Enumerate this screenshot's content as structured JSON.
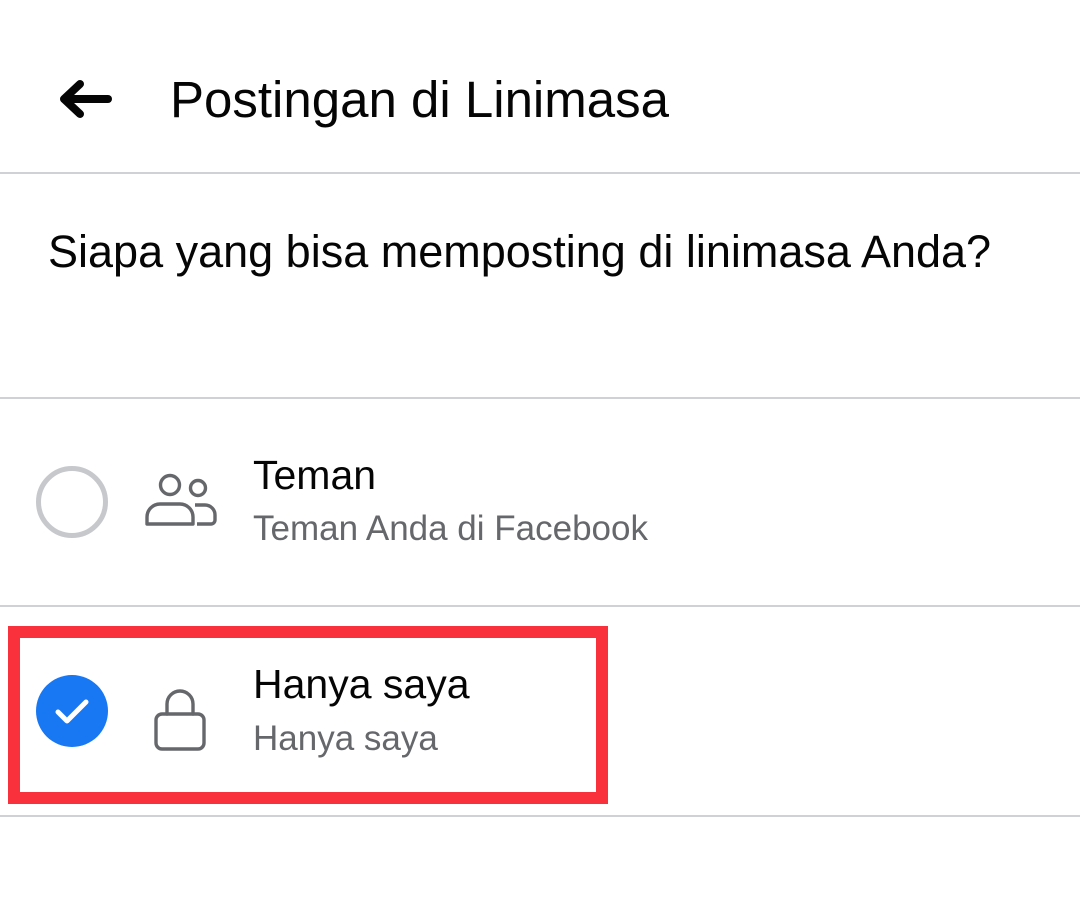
{
  "header": {
    "back_icon": "arrow-left-icon",
    "title": "Postingan di Linimasa"
  },
  "question": {
    "text": "Siapa yang bisa memposting di linimasa Anda?"
  },
  "options": [
    {
      "title": "Teman",
      "subtitle": "Teman Anda di Facebook",
      "icon": "friends-icon",
      "selected": false
    },
    {
      "title": "Hanya saya",
      "subtitle": "Hanya saya",
      "icon": "lock-icon",
      "selected": true
    }
  ],
  "colors": {
    "accent": "#1877f2",
    "highlight": "#f8313d",
    "divider": "#cfd1d4",
    "secondary_text": "#65676b"
  }
}
